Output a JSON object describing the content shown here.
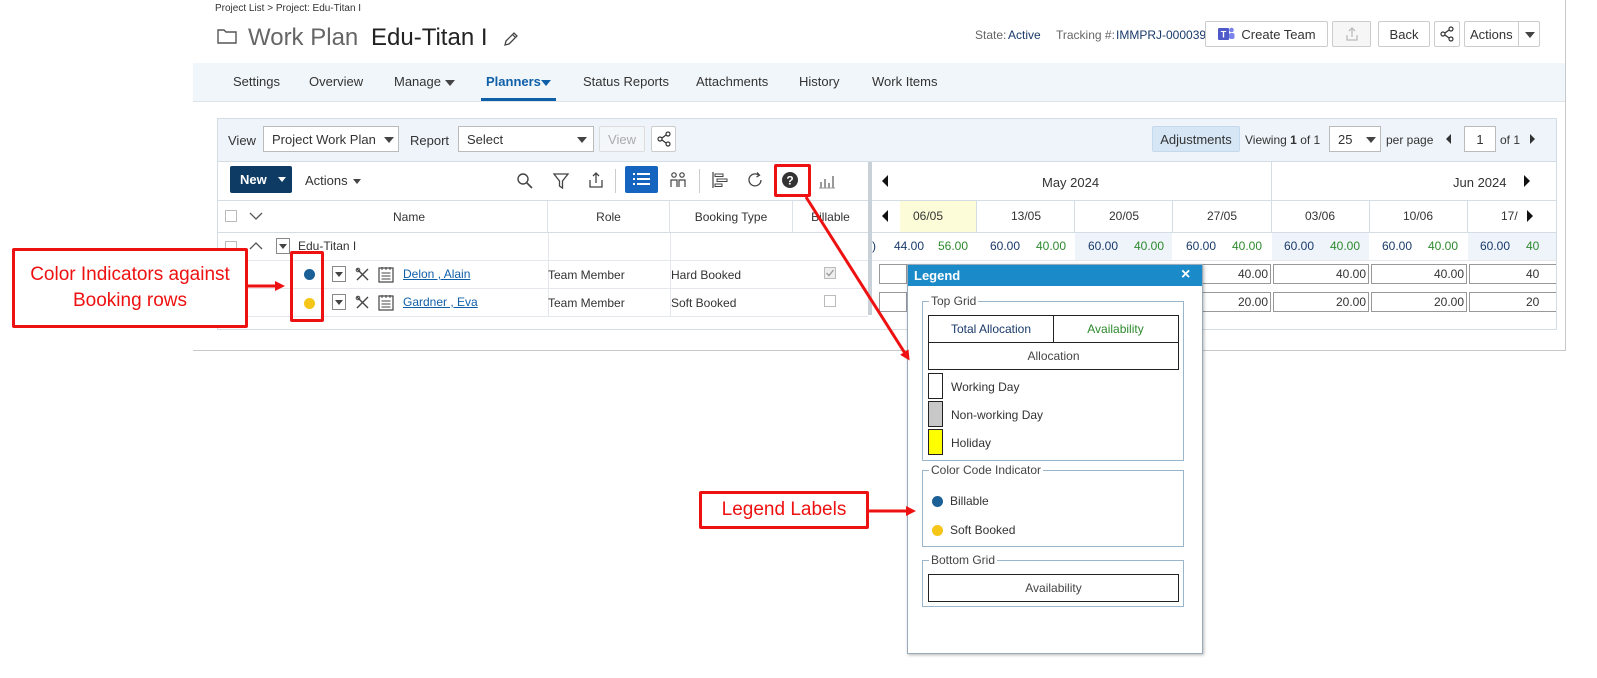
{
  "breadcrumb": "Project List > Project: Edu-Titan I",
  "page_title": "Work Plan",
  "project_name": "Edu-Titan I",
  "state_label": "State:",
  "state_value": "Active",
  "tracking_label": "Tracking #:",
  "tracking_value": "IMMPRJ-000039",
  "header_buttons": {
    "create_team": "Create Team",
    "back": "Back",
    "actions": "Actions"
  },
  "nav": {
    "settings": "Settings",
    "overview": "Overview",
    "manage": "Manage",
    "planners": "Planners",
    "status_reports": "Status Reports",
    "attachments": "Attachments",
    "history": "History",
    "work_items": "Work Items"
  },
  "toolbar": {
    "view_label": "View",
    "view_value": "Project Work Plan",
    "report_label": "Report",
    "report_value": "Select",
    "view_button": "View",
    "adjustments": "Adjustments",
    "viewing_prefix": "Viewing",
    "viewing_page": "1",
    "viewing_of": "of 1",
    "per_page_value": "25",
    "per_page_label": "per page",
    "page_value": "1",
    "page_of": "of 1"
  },
  "grid_toolbar": {
    "new": "New",
    "actions": "Actions"
  },
  "columns": {
    "name": "Name",
    "role": "Role",
    "booking_type": "Booking Type",
    "billable": "Billable"
  },
  "months": {
    "may": "May 2024",
    "jun": "Jun 2024"
  },
  "weeks": [
    "06/05",
    "13/05",
    "20/05",
    "27/05",
    "03/06",
    "10/06",
    "17/"
  ],
  "project_row": {
    "name": "Edu-Titan I",
    "lead": ")",
    "pairs": [
      [
        "44.00",
        "56.00"
      ],
      [
        "60.00",
        "40.00"
      ],
      [
        "60.00",
        "40.00"
      ],
      [
        "60.00",
        "40.00"
      ],
      [
        "60.00",
        "40.00"
      ],
      [
        "60.00",
        "40.00"
      ],
      [
        "60.00",
        "40"
      ]
    ]
  },
  "rows": [
    {
      "name": "Delon , Alain",
      "role": "Team Member",
      "booking_type": "Hard Booked",
      "billable": true,
      "indicator": "#1a5f96",
      "values": [
        "40.00",
        "40.00",
        "40.00",
        "40"
      ]
    },
    {
      "name": "Gardner , Eva",
      "role": "Team Member",
      "booking_type": "Soft Booked",
      "billable": false,
      "indicator": "#f5c518",
      "values": [
        "20.00",
        "20.00",
        "20.00",
        "20"
      ]
    }
  ],
  "legend": {
    "title": "Legend",
    "close": "×",
    "top_grid": "Top Grid",
    "total_allocation": "Total Allocation",
    "availability": "Availability",
    "allocation": "Allocation",
    "working_day": "Working Day",
    "non_working_day": "Non-working Day",
    "holiday": "Holiday",
    "color_code": "Color Code Indicator",
    "billable": "Billable",
    "soft_booked": "Soft Booked",
    "bottom_grid": "Bottom Grid",
    "bottom_availability": "Availability"
  },
  "callouts": {
    "color_indicators": "Color Indicators against Booking rows",
    "legend_labels": "Legend Labels"
  },
  "colors": {
    "primary_blue": "#0f5fa8",
    "new_button": "#0d3b63",
    "legend_header": "#1b8ac9",
    "billable_dot": "#1a5f96",
    "soft_dot": "#f5c518",
    "holiday": "#ffff00",
    "non_working": "#c8c8c8",
    "callout_red": "#ee1111",
    "green_text": "#2d8a2d"
  }
}
